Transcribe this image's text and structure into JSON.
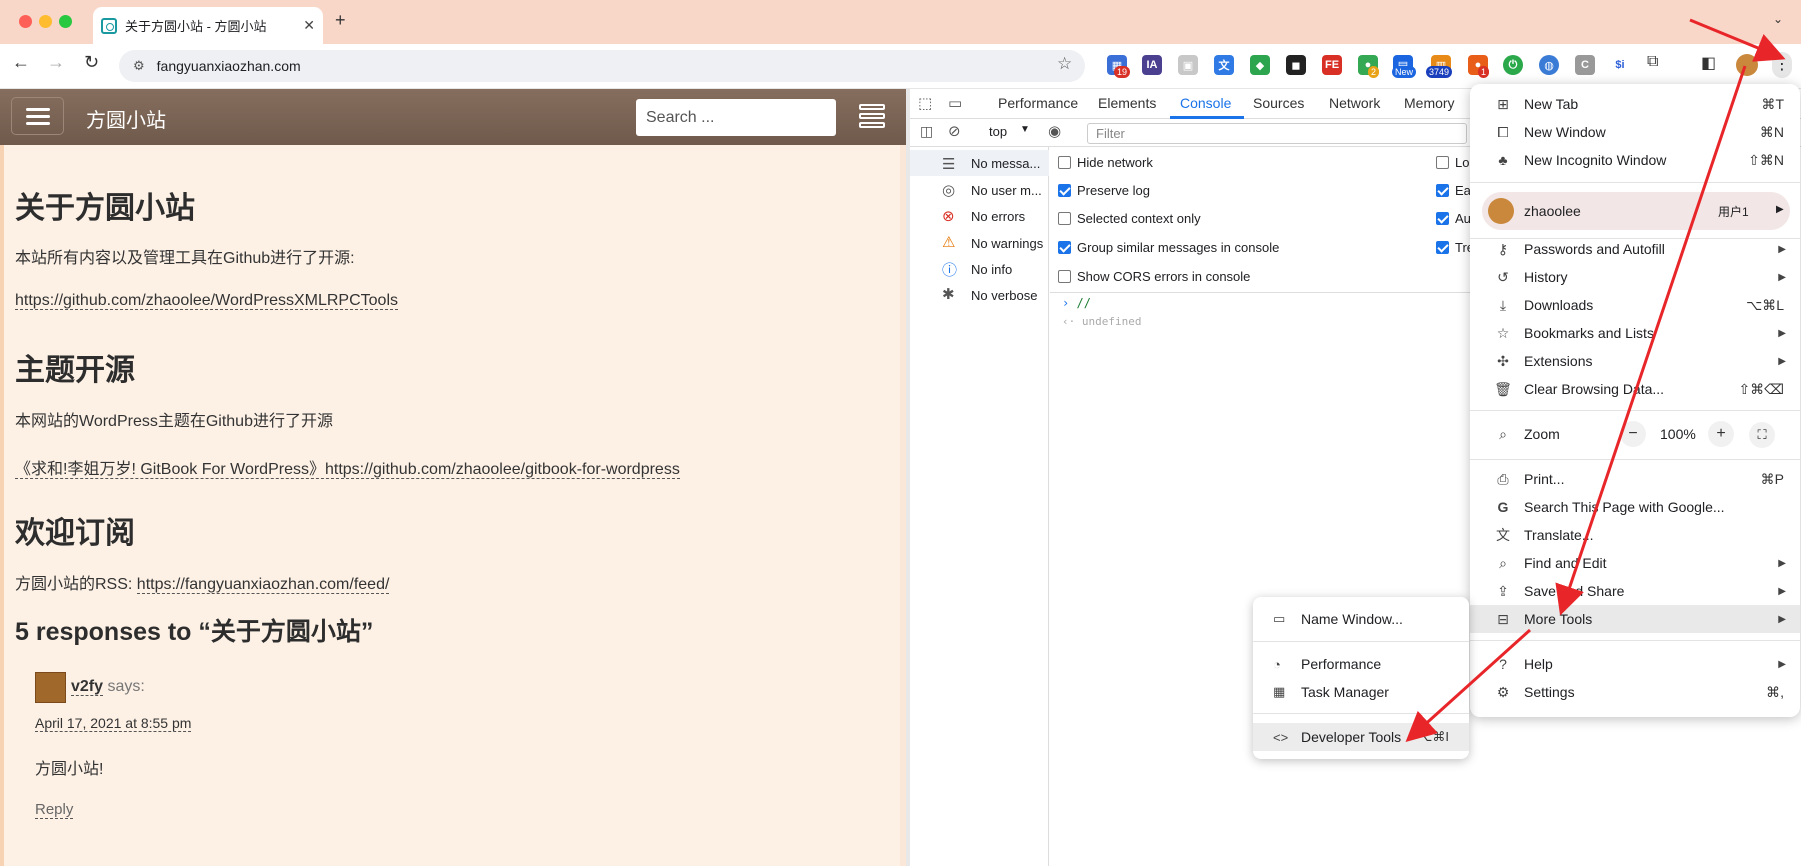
{
  "browser": {
    "tab_title": "关于方圆小站 - 方圆小站",
    "new_tab_symbol": "+",
    "url": "fangyuanxiaozhan.com",
    "ext_badges": {
      "first": "19",
      "second": "2",
      "new": "New",
      "count": "3749",
      "red": "1"
    }
  },
  "site": {
    "title": "方圆小站",
    "search_placeholder": "Search ...",
    "h_about": "关于方圆小站",
    "p_open": "本站所有内容以及管理工具在Github进行了开源:",
    "link_tools": "https://github.com/zhaoolee/WordPressXMLRPCTools",
    "h_theme": "主题开源",
    "p_theme": "本网站的WordPress主题在Github进行了开源",
    "link_theme": "《求和!李姐万岁! GitBook For WordPress》https://github.com/zhaoolee/gitbook-for-wordpress",
    "h_sub": "欢迎订阅",
    "rss_label": "方圆小站的RSS: ",
    "rss_link": "https://fangyuanxiaozhan.com/feed/",
    "h_responses": "5 responses to “关于方圆小站”",
    "comment_author": "v2fy",
    "comment_says": " says:",
    "comment_date": "April 17, 2021 at 8:55 pm",
    "comment_text": "方圆小站!",
    "reply": "Reply"
  },
  "devtools": {
    "tabs": [
      "Performance",
      "Elements",
      "Console",
      "Sources",
      "Network",
      "Memory"
    ],
    "active_tab": "Console",
    "context": "top",
    "filter_placeholder": "Filter",
    "side": [
      "No messa...",
      "No user m...",
      "No errors",
      "No warnings",
      "No info",
      "No verbose"
    ],
    "checkboxes": [
      {
        "label": "Hide network",
        "checked": false
      },
      {
        "label": "Preserve log",
        "checked": true
      },
      {
        "label": "Selected context only",
        "checked": false
      },
      {
        "label": "Group similar messages in console",
        "checked": true
      },
      {
        "label": "Show CORS errors in console",
        "checked": false
      }
    ],
    "right_checkboxes": [
      {
        "label": "Lo",
        "checked": false
      },
      {
        "label": "Ea",
        "checked": true
      },
      {
        "label": "Au",
        "checked": true
      },
      {
        "label": "Tre",
        "checked": true
      }
    ],
    "console_input": "//",
    "console_output": "undefined"
  },
  "menu": {
    "new_tab": "New Tab",
    "new_tab_sc": "⌘T",
    "new_window": "New Window",
    "new_window_sc": "⌘N",
    "incognito": "New Incognito Window",
    "incognito_sc": "⇧⌘N",
    "profile_name": "zhaoolee",
    "profile_tag": "用户1",
    "passwords": "Passwords and Autofill",
    "history": "History",
    "downloads": "Downloads",
    "downloads_sc": "⌥⌘L",
    "bookmarks": "Bookmarks and Lists",
    "extensions": "Extensions",
    "clear": "Clear Browsing Data...",
    "clear_sc": "⇧⌘⌫",
    "zoom": "Zoom",
    "zoom_minus": "−",
    "zoom_value": "100%",
    "zoom_plus": "+",
    "print": "Print...",
    "print_sc": "⌘P",
    "search_google": "Search This Page with Google...",
    "translate": "Translate...",
    "find_edit": "Find and Edit",
    "save_share": "Save and Share",
    "more_tools": "More Tools",
    "help": "Help",
    "settings": "Settings",
    "settings_sc": "⌘,"
  },
  "submenu": {
    "name_window": "Name Window...",
    "performance": "Performance",
    "task_manager": "Task Manager",
    "dev_tools": "Developer Tools",
    "dev_tools_sc": "⌥⌘I"
  },
  "colors": {
    "accent": "#1a73e8",
    "annotation_arrow": "#e8262a",
    "site_header": "#7a6454",
    "titlebar": "#f9d7c8"
  }
}
